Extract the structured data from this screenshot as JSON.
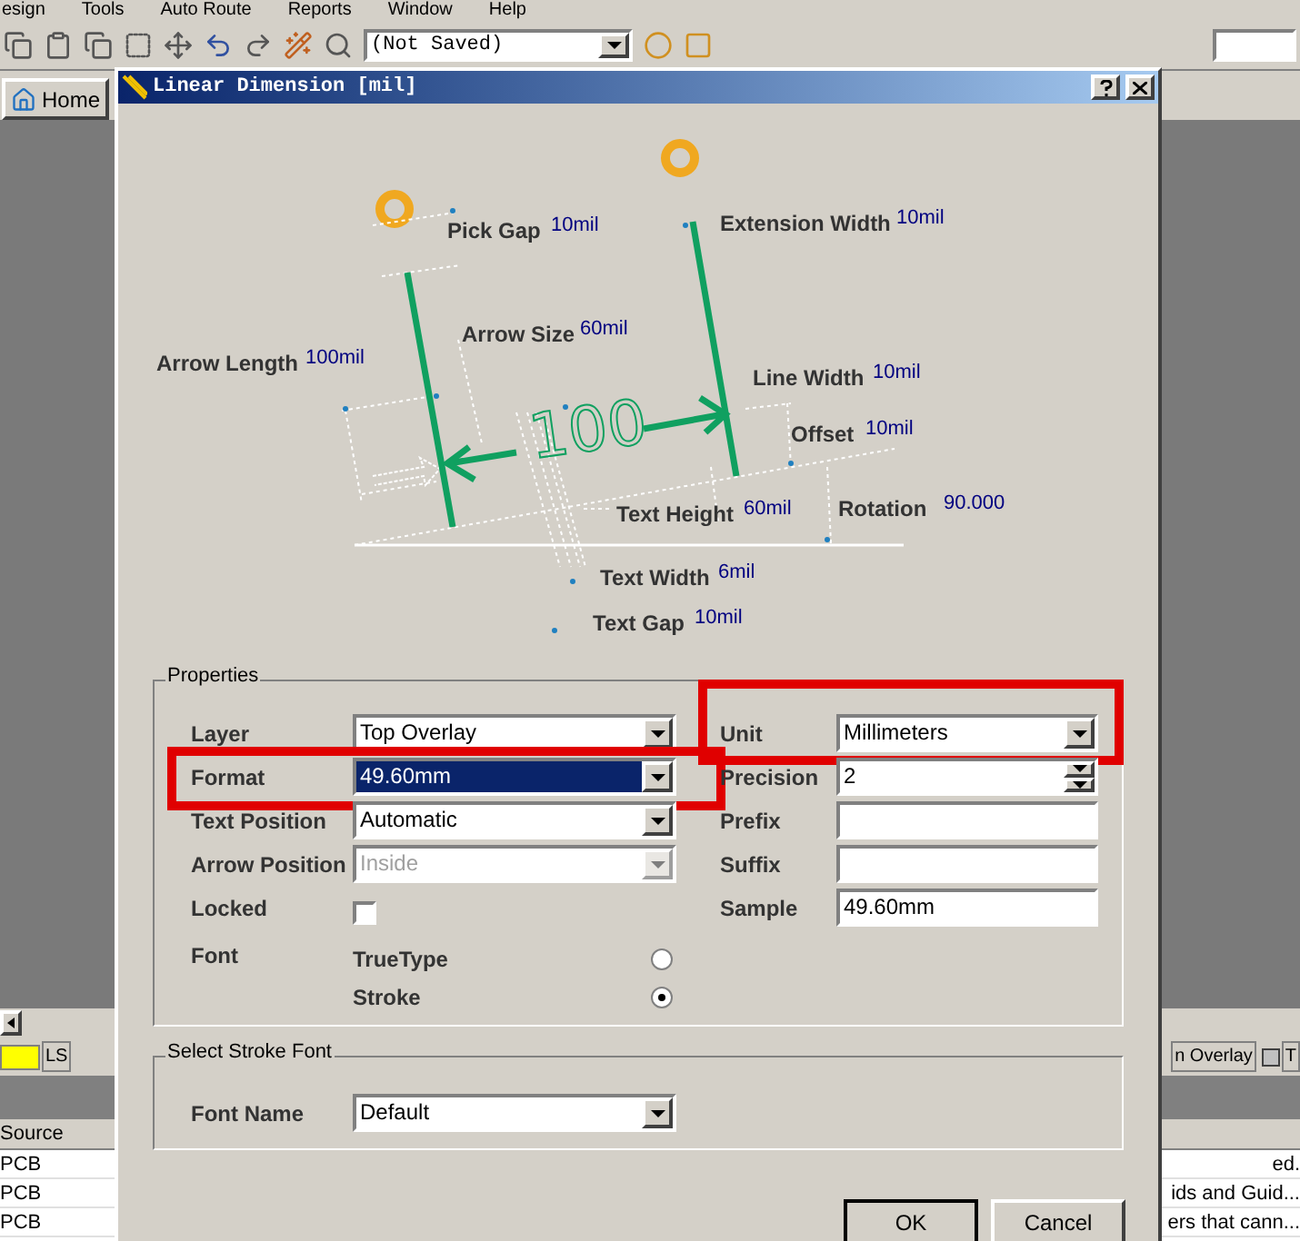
{
  "app": {
    "menu": [
      "esign",
      "Tools",
      "Auto Route",
      "Reports",
      "Window",
      "Help"
    ],
    "toolbar": {
      "document_combo": "(Not Saved)"
    },
    "home_tab": "Home",
    "layer_tabs": [
      {
        "label": "LS",
        "color": "#ffff00"
      },
      {
        "label": "n Overlay"
      },
      {
        "label": "T",
        "color": "#c0c0c0"
      }
    ],
    "messages": {
      "columns": [
        "Source"
      ],
      "rows": [
        {
          "source": "PCB",
          "column_2": "ed."
        },
        {
          "source": "PCB",
          "column_2": "ids and Guid..."
        },
        {
          "source": "PCB",
          "column_2": "ers that cann..."
        }
      ]
    }
  },
  "dialog": {
    "title": "Linear Dimension [mil]",
    "diagram": {
      "dimension_text": "100",
      "labels": [
        {
          "label": "Pick Gap",
          "value": "10mil"
        },
        {
          "label": "Extension Width",
          "value": "10mil"
        },
        {
          "label": "Arrow Size",
          "value": "60mil"
        },
        {
          "label": "Arrow Length",
          "value": "100mil"
        },
        {
          "label": "Line Width",
          "value": "10mil"
        },
        {
          "label": "Offset",
          "value": "10mil"
        },
        {
          "label": "Text Height",
          "value": "60mil"
        },
        {
          "label": "Rotation",
          "value": "90.000"
        },
        {
          "label": "Text Width",
          "value": "6mil"
        },
        {
          "label": "Text Gap",
          "value": "10mil"
        }
      ]
    },
    "properties": {
      "title": "Properties",
      "left": [
        {
          "kind": "dropdown",
          "label": "Layer",
          "value": "Top Overlay",
          "selected": false,
          "disabled": false,
          "highlighted": false
        },
        {
          "kind": "dropdown",
          "label": "Format",
          "value": "49.60mm",
          "selected": true,
          "disabled": false,
          "highlighted": true
        },
        {
          "kind": "dropdown",
          "label": "Text Position",
          "value": "Automatic",
          "selected": false,
          "disabled": false,
          "highlighted": false
        },
        {
          "kind": "dropdown",
          "label": "Arrow Position",
          "value": "Inside",
          "selected": false,
          "disabled": true,
          "highlighted": false
        },
        {
          "kind": "checkbox",
          "label": "Locked",
          "checked": false
        }
      ],
      "font": {
        "label": "Font",
        "options": [
          {
            "label": "TrueType",
            "selected": false
          },
          {
            "label": "Stroke",
            "selected": true
          }
        ]
      },
      "right": [
        {
          "kind": "dropdown",
          "label": "Unit",
          "value": "Millimeters",
          "highlighted": true
        },
        {
          "kind": "spinner",
          "label": "Precision",
          "value": "2",
          "highlighted": false
        },
        {
          "kind": "text",
          "label": "Prefix",
          "highlighted": false
        },
        {
          "kind": "text",
          "label": "Suffix",
          "highlighted": false
        },
        {
          "kind": "text",
          "label": "Sample",
          "value": "49.60mm",
          "highlighted": false
        }
      ]
    },
    "stroke_font": {
      "title": "Select Stroke Font",
      "label": "Font Name",
      "value": "Default"
    },
    "buttons": [
      "OK",
      "Cancel"
    ]
  }
}
